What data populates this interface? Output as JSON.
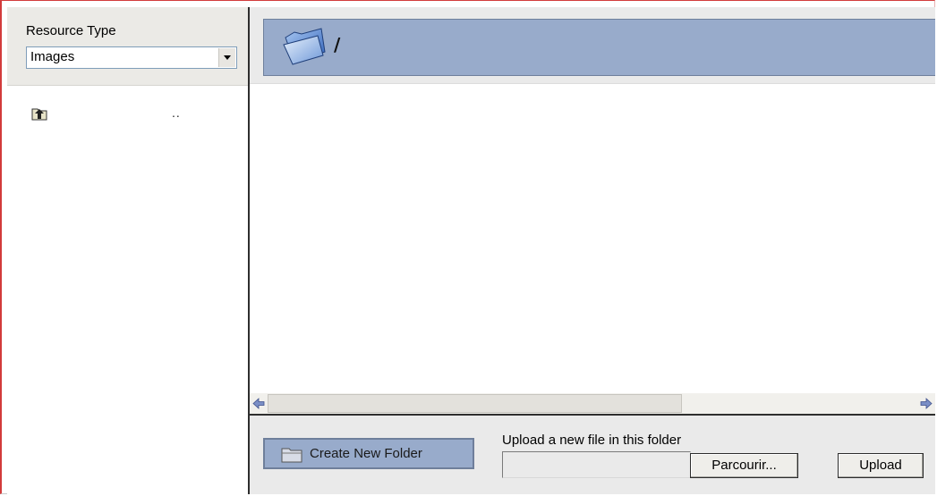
{
  "sidebar": {
    "resource_type_label": "Resource Type",
    "resource_type_value": "Images",
    "items": [
      {
        "icon": "folder-up-icon",
        "label": ".."
      }
    ]
  },
  "header": {
    "current_path": "/",
    "path_icon": "open-folder-icon"
  },
  "footer": {
    "create_folder_label": "Create New Folder",
    "upload_label": "Upload a new file in this folder",
    "browse_label": "Parcourir...",
    "upload_button_label": "Upload"
  },
  "colors": {
    "accent": "#98abcb",
    "panel": "#eaeaea",
    "border_red": "#d23b3b"
  }
}
